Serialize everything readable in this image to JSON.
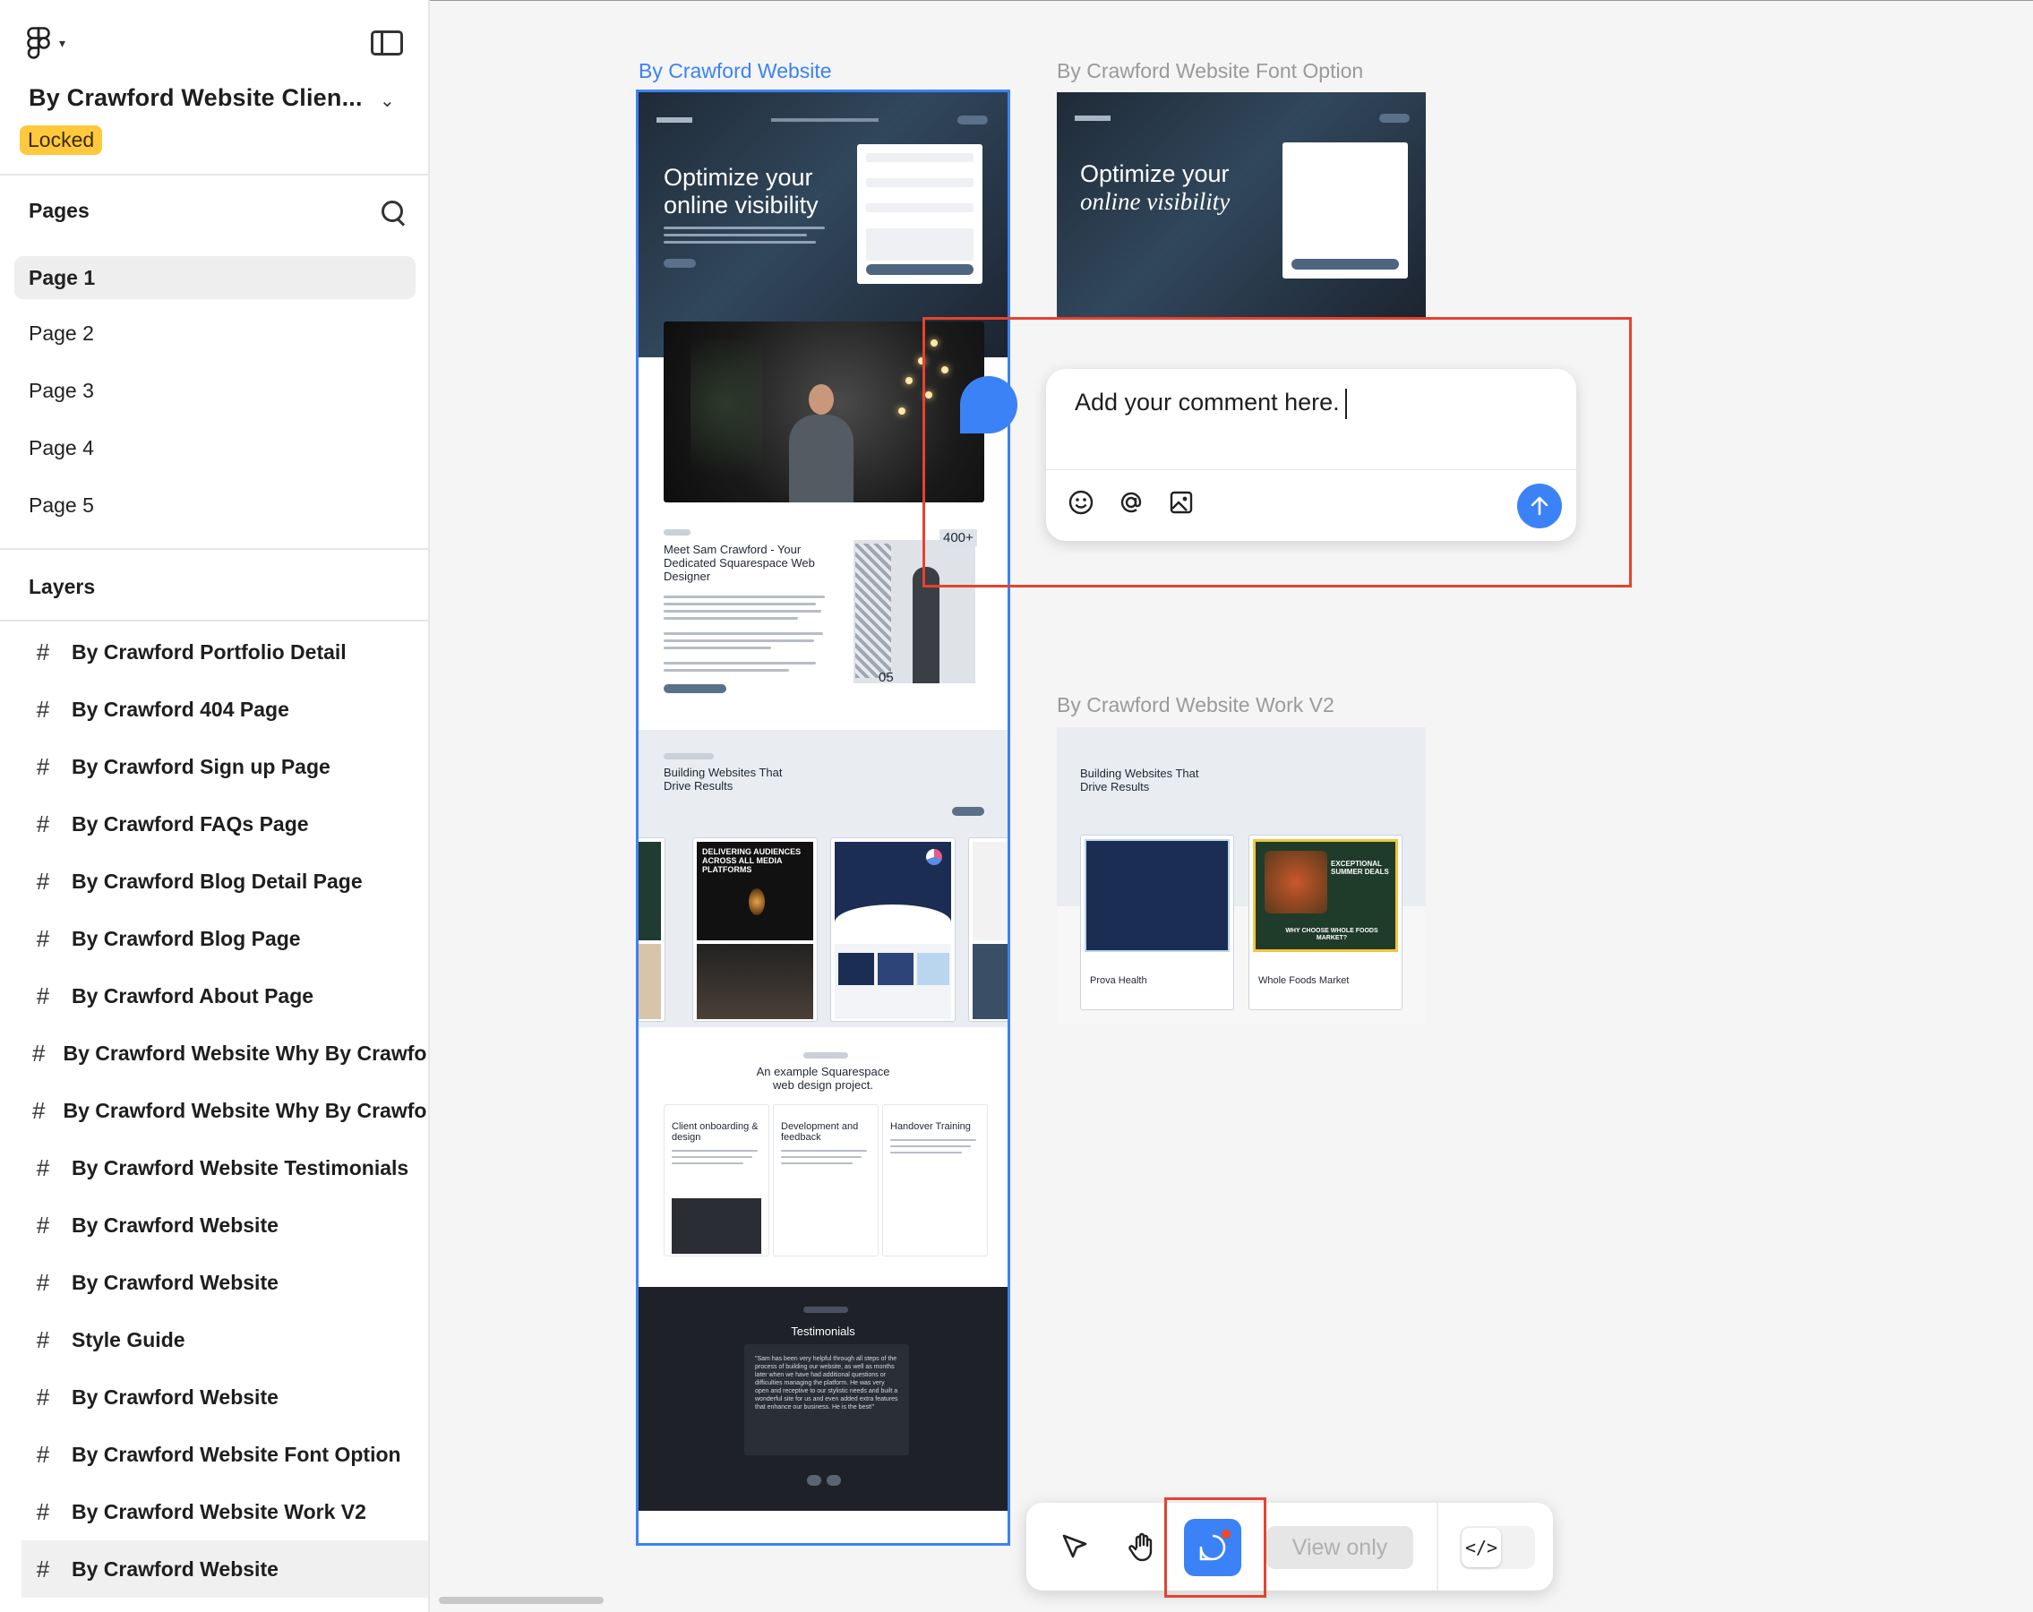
{
  "file": {
    "title": "By Crawford Website Clien...",
    "status": "Locked"
  },
  "pages": {
    "heading": "Pages",
    "items": [
      "Page 1",
      "Page 2",
      "Page 3",
      "Page 4",
      "Page 5"
    ],
    "active": "Page 1"
  },
  "layers": {
    "heading": "Layers",
    "items": [
      "By Crawford Portfolio Detail",
      "By Crawford 404 Page",
      "By Crawford Sign up Page",
      "By Crawford FAQs Page",
      "By Crawford Blog Detail Page",
      "By Crawford Blog Page",
      "By Crawford About Page",
      "By Crawford Website Why By Crawfor",
      "By Crawford Website Why By Crawfor",
      "By Crawford Website Testimonials",
      "By Crawford Website",
      "By Crawford Website",
      "Style Guide",
      "By Crawford Website",
      "By Crawford Website Font Option",
      "By Crawford Website Work V2",
      "By Crawford Website"
    ],
    "selected_index": 16
  },
  "canvas": {
    "frames": {
      "main_label": "By Crawford Website",
      "font_option_label": "By Crawford Website Font Option",
      "work_v2_label": "By Crawford Website Work V2"
    },
    "preview": {
      "hero_line1": "Optimize your",
      "hero_line2": "online visibility",
      "meet_title": "Meet Sam Crawford - Your Dedicated Squarespace Web Designer",
      "stat_top": "400+",
      "stat_bottom": "05",
      "work_title_1": "Building Websites That",
      "work_title_2": "Drive Results",
      "card_heading": "DELIVERING AUDIENCES ACROSS ALL MEDIA PLATFORMS",
      "example_title_1": "An example Squarespace",
      "example_title_2": "web design project.",
      "step1": "Client onboarding & design",
      "step2": "Development and feedback",
      "step3": "Handover Training",
      "testimonials_title": "Testimonials",
      "testimonial_text": "\"Sam has been very helpful through all steps of the process of building our website, as well as months later when we have had additional questions or difficulties managing the platform. He was very open and receptive to our stylistic needs and built a wonderful site for us and even added extra features that enhance our business. He is the best!\"",
      "work_card_1": "Prova Health",
      "work_card_2": "Whole Foods Market",
      "work_card_2_headline": "EXCEPTIONAL SUMMER DEALS",
      "work_card_2_sub": "WHY CHOOSE WHOLE FOODS MARKET?"
    }
  },
  "comment": {
    "text": "Add your comment here.",
    "emoji_icon": "emoji-icon",
    "mention_icon": "at-icon",
    "image_icon": "image-icon",
    "send_icon": "arrow-up-icon"
  },
  "toolbar": {
    "view_only": "View only",
    "tools": [
      "move-tool",
      "hand-tool",
      "comment-tool",
      "dev-mode-toggle"
    ],
    "active_tool": "comment-tool"
  },
  "colors": {
    "accent": "#3b82f6",
    "highlight": "#e5432f",
    "locked_badge": "#ffc83d"
  }
}
